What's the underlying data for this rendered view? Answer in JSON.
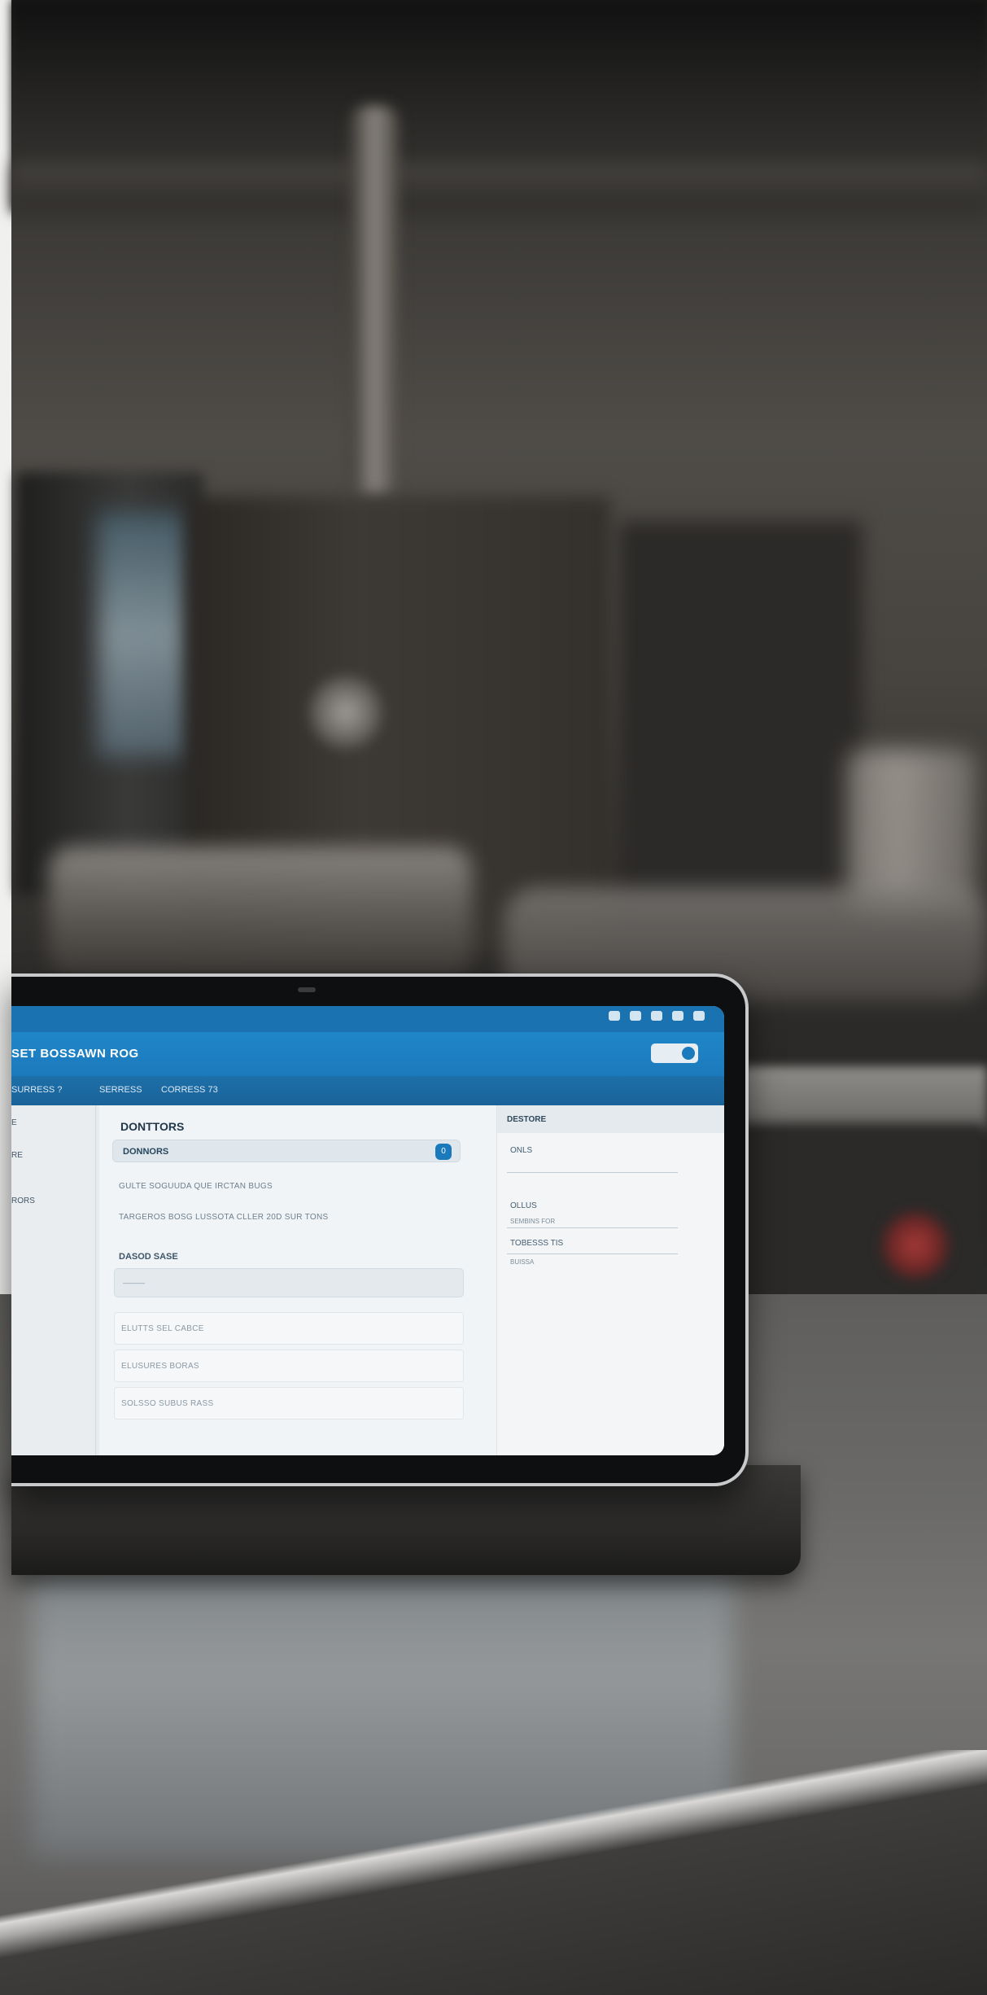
{
  "app": {
    "title": "SET BOSSAWN ROG",
    "status_icons": [
      "signal-icon",
      "wifi-icon",
      "location-icon",
      "battery-icon",
      "eye-icon"
    ]
  },
  "subnav": {
    "items": [
      "SURRESS ?",
      "SERRESS",
      "CORRESS 73"
    ]
  },
  "sidebar": {
    "items": [
      "E",
      "RE",
      "RORS"
    ]
  },
  "main": {
    "title": "DONTTORS",
    "selected_row": {
      "label": "DONNORS",
      "badge": "0"
    },
    "text_lines": [
      "GULTE SOGUUDA   QUE IRCTAN BUGS",
      "TARGEROS BOSG LUSSOTA      CLLER 20D SUR TONS"
    ],
    "section_label": "DASOD SASE",
    "input_value": "———",
    "list_rows": [
      "ELUTTS SEL CABCE",
      "ELUSURES BORAS",
      "SOLSSO SUBUS RASS"
    ]
  },
  "detail": {
    "header": "DESTORE",
    "items": [
      "ONLS",
      "OLLUS",
      "SEMBINS FOR",
      "TOBESSS TIS",
      "BUISSA"
    ]
  },
  "colors": {
    "accent": "#1b7abc",
    "appbar": "#1f86c8",
    "screen_bg": "#e7ecef"
  }
}
